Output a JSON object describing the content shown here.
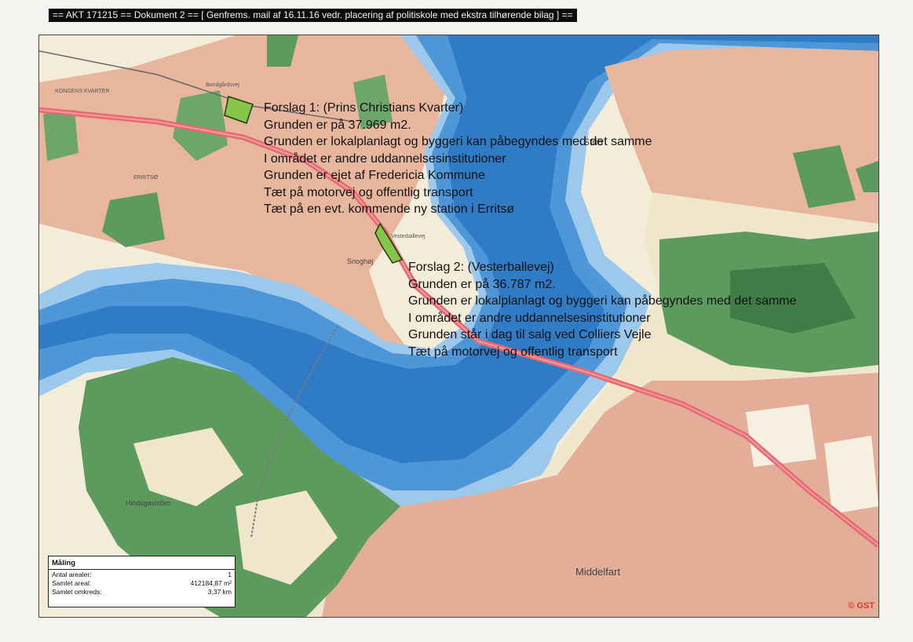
{
  "header": {
    "text": "== AKT 171215 == Dokument 2 == [ Genfrems. mail af 16.11.16 vedr. placering af politiskole med ekstra tilhørende bilag ] =="
  },
  "proposals": [
    {
      "lines": [
        "Forslag 1: (Prins Christians Kvarter)",
        "Grunden er på 37.969 m2.",
        "Grunden er lokalplanlagt og byggeri kan påbegyndes med det samme",
        "I området er andre uddannelsesinstitutioner",
        "Grunden er ejet af Fredericia Kommune",
        "Tæt på motorvej og offentlig transport",
        "Tæt på en evt. kommende ny station i Erritsø"
      ]
    },
    {
      "lines": [
        "Forslag 2: (Vesterballevej)",
        "Grunden er på 36.787 m2.",
        "Grunden er lokalplanlagt og byggeri kan påbegyndes med det samme",
        "I området er andre uddannelsesinstitutioner",
        "Grunden står i dag til salg ved Colliers Vejle",
        "Tæt på motorvej og offentlig transport"
      ]
    }
  ],
  "places": {
    "strib": "Strib",
    "middelfart": "Middelfart",
    "snoghoj": "Snoghøj",
    "hindsgavl": "Hindsgavlsbro",
    "kongens_kvarter": "KONGENS KVARTER",
    "bundgaarden": "Bundgårdsvej",
    "vesterballevej": "Vesterballevej",
    "erritso": "ERRITSØ"
  },
  "legend": {
    "title": "Måling",
    "rows": [
      {
        "label": "Antal arealer:",
        "value": "1"
      },
      {
        "label": "Samlet areal:",
        "value": "412184,87 m²"
      },
      {
        "label": "Samlet omkreds:",
        "value": "3,37 km"
      }
    ]
  },
  "copyright": "© GST",
  "colors": {
    "water_deep": "#2f7bc6",
    "water_mid": "#4d96d8",
    "water_shallow": "#9cc8ec",
    "land": "#f3ecd9",
    "urban": "#e8b69d",
    "forest": "#4f8a54",
    "road_main": "#e56a72",
    "site_polygon": "#86c44a"
  }
}
